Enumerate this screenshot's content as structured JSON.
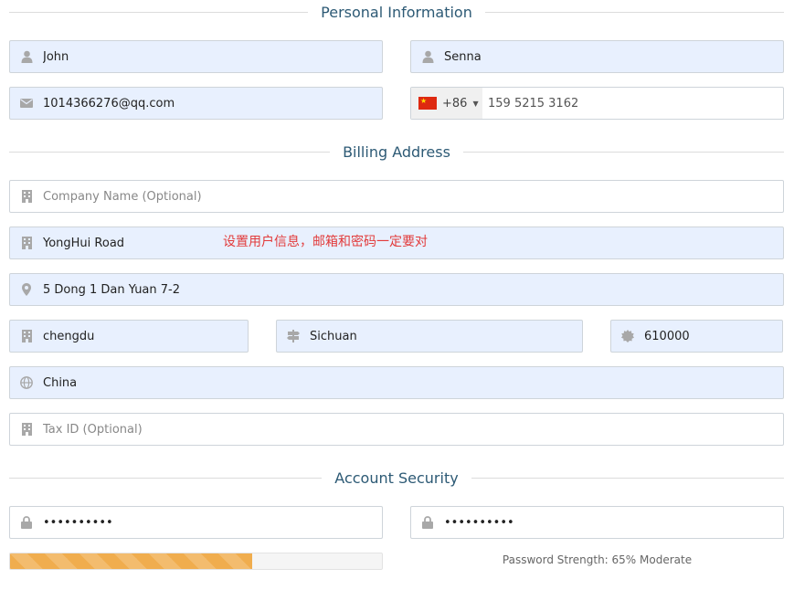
{
  "personal": {
    "title": "Personal Information",
    "first_name": "John",
    "last_name": "Senna",
    "email": "1014366276@qq.com",
    "phone_code": "+86",
    "phone_number": "159 5215 3162"
  },
  "billing": {
    "title": "Billing Address",
    "company_placeholder": "Company Name (Optional)",
    "address1": "YongHui Road",
    "address2": "5 Dong 1 Dan Yuan 7-2",
    "city": "chengdu",
    "state": "Sichuan",
    "zip": "610000",
    "country": "China",
    "tax_placeholder": "Tax ID (Optional)"
  },
  "note": "设置用户信息，邮箱和密码一定要对",
  "security": {
    "title": "Account Security",
    "password": "••••••••••",
    "confirm_password": "••••••••••",
    "strength_percent": 65,
    "strength_text": "Password Strength: 65% Moderate"
  },
  "colors": {
    "accent": "#2d5a75",
    "autofill_bg": "#e8f0fe",
    "strength_bar": "#f0ad4e",
    "note": "#e23b3b"
  }
}
